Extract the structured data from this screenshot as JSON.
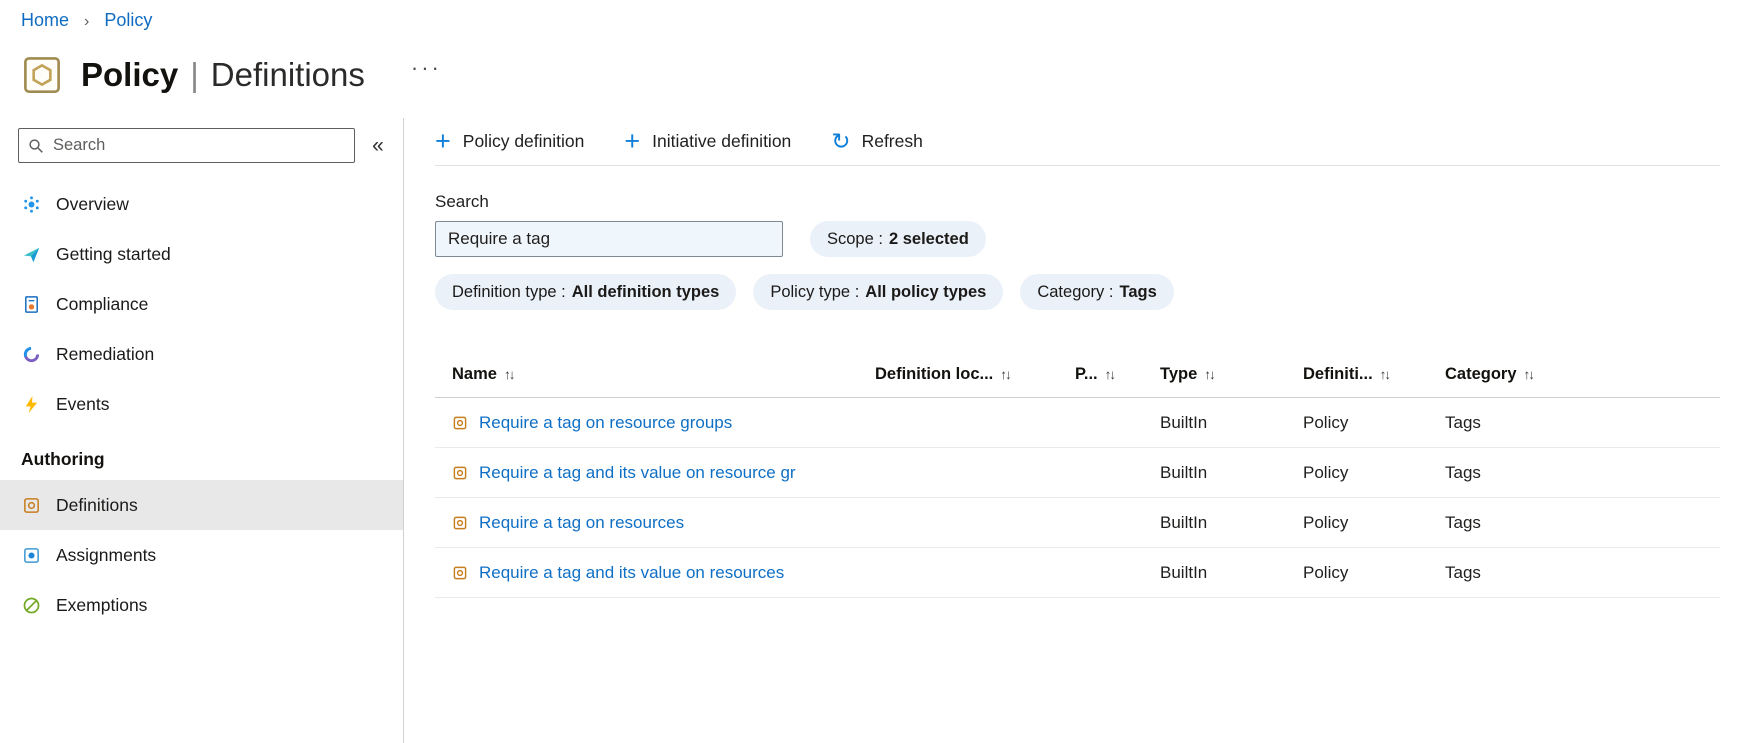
{
  "breadcrumb": {
    "home": "Home",
    "separator": "›",
    "current": "Policy"
  },
  "header": {
    "title_primary": "Policy",
    "title_divider": "|",
    "title_secondary": "Definitions",
    "more": "···"
  },
  "sidebar": {
    "search_placeholder": "Search",
    "collapse_glyph": "«",
    "items": [
      {
        "label": "Overview"
      },
      {
        "label": "Getting started"
      },
      {
        "label": "Compliance"
      },
      {
        "label": "Remediation"
      },
      {
        "label": "Events"
      }
    ],
    "section_label": "Authoring",
    "authoring_items": [
      {
        "label": "Definitions"
      },
      {
        "label": "Assignments"
      },
      {
        "label": "Exemptions"
      }
    ]
  },
  "toolbar": {
    "plus_glyph": "+",
    "policy_definition": "Policy definition",
    "initiative_definition": "Initiative definition",
    "refresh_glyph": "↻",
    "refresh": "Refresh"
  },
  "filters": {
    "search_label": "Search",
    "search_value": "Require a tag",
    "pills": [
      {
        "label": "Scope :",
        "value": "2 selected"
      },
      {
        "label": "Definition type :",
        "value": "All definition types"
      },
      {
        "label": "Policy type :",
        "value": "All policy types"
      },
      {
        "label": "Category :",
        "value": "Tags"
      }
    ]
  },
  "table": {
    "sort_glyph": "↑↓",
    "headers": [
      "Name",
      "Definition loc...",
      "P...",
      "Type",
      "Definiti...",
      "Category"
    ],
    "rows": [
      {
        "name": "Require a tag on resource groups",
        "type": "BuiltIn",
        "definition_type": "Policy",
        "category": "Tags"
      },
      {
        "name": "Require a tag and its value on resource gr",
        "type": "BuiltIn",
        "definition_type": "Policy",
        "category": "Tags"
      },
      {
        "name": "Require a tag on resources",
        "type": "BuiltIn",
        "definition_type": "Policy",
        "category": "Tags"
      },
      {
        "name": "Require a tag and its value on resources",
        "type": "BuiltIn",
        "definition_type": "Policy",
        "category": "Tags"
      }
    ]
  },
  "colors": {
    "accent": "#0078d4",
    "link": "#0f6fc5",
    "pill_bg": "#ebf1f8",
    "selected_bg": "#e8e8e8"
  }
}
